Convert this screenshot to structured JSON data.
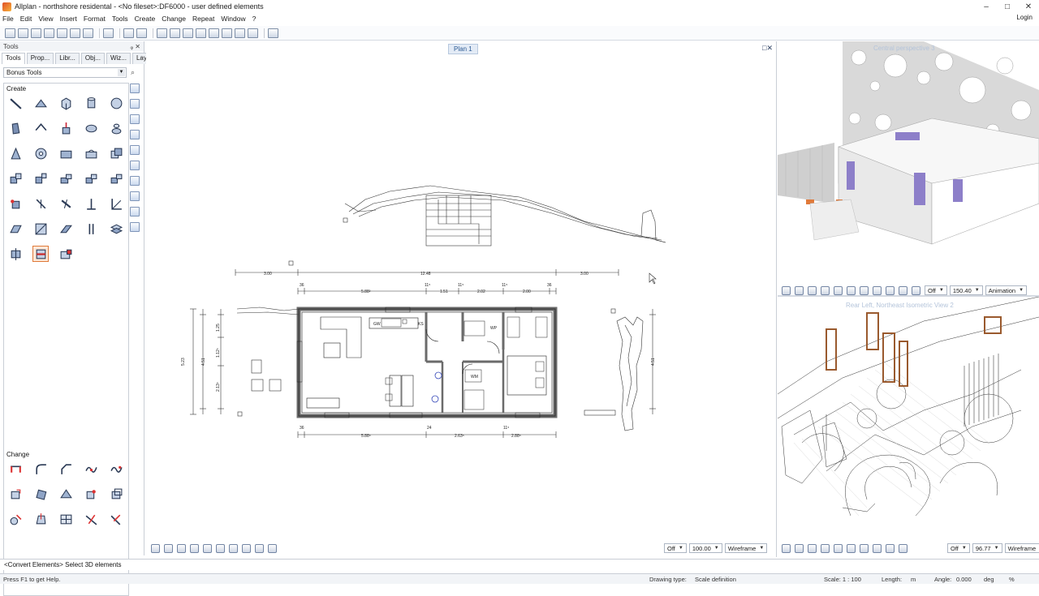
{
  "window": {
    "title": "Allplan - northshore residental - <No fileset>:DF6000 - user defined elements",
    "controls": [
      "–",
      "□",
      "✕"
    ]
  },
  "menu": [
    "File",
    "Edit",
    "View",
    "Insert",
    "Format",
    "Tools",
    "Create",
    "Change",
    "Repeat",
    "Window",
    "?"
  ],
  "login_label": "Login",
  "palette": {
    "header": "Tools",
    "header_controls": "ᵩ ✕",
    "tabs": [
      "Tools",
      "Prop...",
      "Libr...",
      "Obj...",
      "Wiz...",
      "Layers"
    ],
    "active_tab": "Tools",
    "selected_family": "Bonus Tools",
    "create_label": "Create",
    "change_label": "Change"
  },
  "plan": {
    "label": "Plan 1",
    "controls": "□✕",
    "dims_top": [
      "3.00",
      "12.48",
      "3.00"
    ],
    "dims_top2": [
      "36",
      "5.88²",
      "11⁵",
      "1.51",
      "11⁵",
      "2.02",
      "11⁵",
      "2.00",
      "36"
    ],
    "dims_bottom": [
      "36",
      "5.88⁵",
      "24",
      "2.63⁵",
      "11⁵",
      "2.88⁵"
    ],
    "dims_left": [
      "5.23",
      "4.51",
      "1.25",
      "1.12⁵",
      "2.13⁵"
    ],
    "room_labels": [
      "GW",
      "KS",
      "WP",
      "WM"
    ],
    "viewbar": {
      "off": "Off",
      "scale": "100.00",
      "mode": "Wireframe"
    }
  },
  "perspective": {
    "label": "Central perspective 3",
    "viewbar": {
      "off": "Off",
      "value": "150.40",
      "mode": "Animation"
    }
  },
  "isometric": {
    "label": "Rear Left, Northeast Isometric View 2",
    "viewbar": {
      "off": "Off",
      "value": "96.77",
      "mode": "Wireframe"
    }
  },
  "command_line": "<Convert Elements> Select 3D elements",
  "status": {
    "help": "Press F1 to get Help.",
    "drawing_type": "Drawing type:",
    "drawing_type_value": "Scale definition",
    "scale": "Scale: 1 : 100",
    "length": "Length:",
    "length_unit": "m",
    "angle": "Angle:",
    "angle_value": "0.000",
    "angle_unit": "deg",
    "percent": "%"
  },
  "colors": {
    "accent": "#2d5b94",
    "panel_border": "#c9ced6",
    "wall_hatch": "#6b6b6b",
    "window_brown": "#9a5a2e",
    "glass_purple": "#8d7fc9"
  }
}
